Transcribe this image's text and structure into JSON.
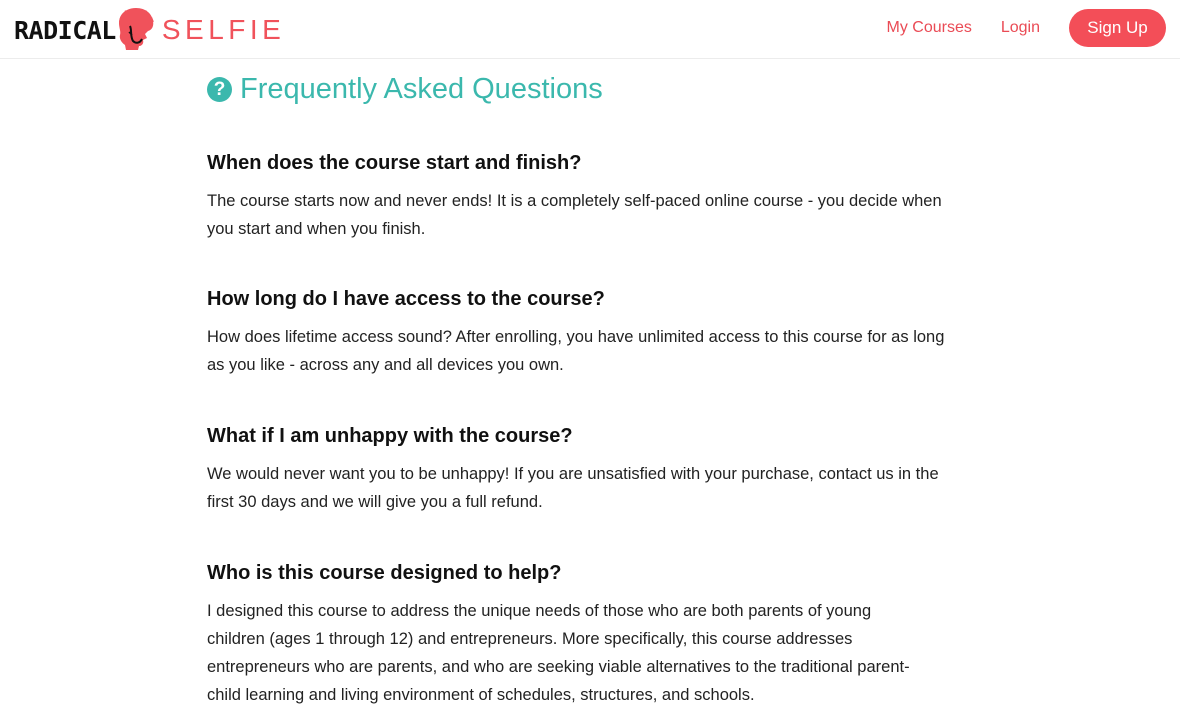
{
  "brand": {
    "name_part1": "RADICAL",
    "name_part2": "SELFIE",
    "accent_color": "#f0525b",
    "head_icon": "afro-head-logo-icon"
  },
  "nav": {
    "my_courses": "My Courses",
    "login": "Login",
    "signup": "Sign Up"
  },
  "faq": {
    "icon": "question-circle-icon",
    "title": "Frequently Asked Questions",
    "title_color": "#3bb8ad",
    "items": [
      {
        "question": "When does the course start and finish?",
        "answer": "The course starts now and never ends! It is a completely self-paced online course - you decide when you start and when you finish."
      },
      {
        "question": "How long do I have access to the course?",
        "answer": "How does lifetime access sound? After enrolling, you have unlimited access to this course for as long as you like - across any and all devices you own."
      },
      {
        "question": "What if I am unhappy with the course?",
        "answer": "We would never want you to be unhappy! If you are unsatisfied with your purchase, contact us in the first 30 days and we will give you a full refund."
      },
      {
        "question": "Who is this course designed to help?",
        "answer": "I designed this course to address the unique needs of those who are both parents of young children (ages 1 through 12) and entrepreneurs. More specifically, this course addresses entrepreneurs who are parents, and who are seeking viable alternatives to the traditional parent-child learning and living environment of schedules, structures, and schools."
      }
    ]
  }
}
